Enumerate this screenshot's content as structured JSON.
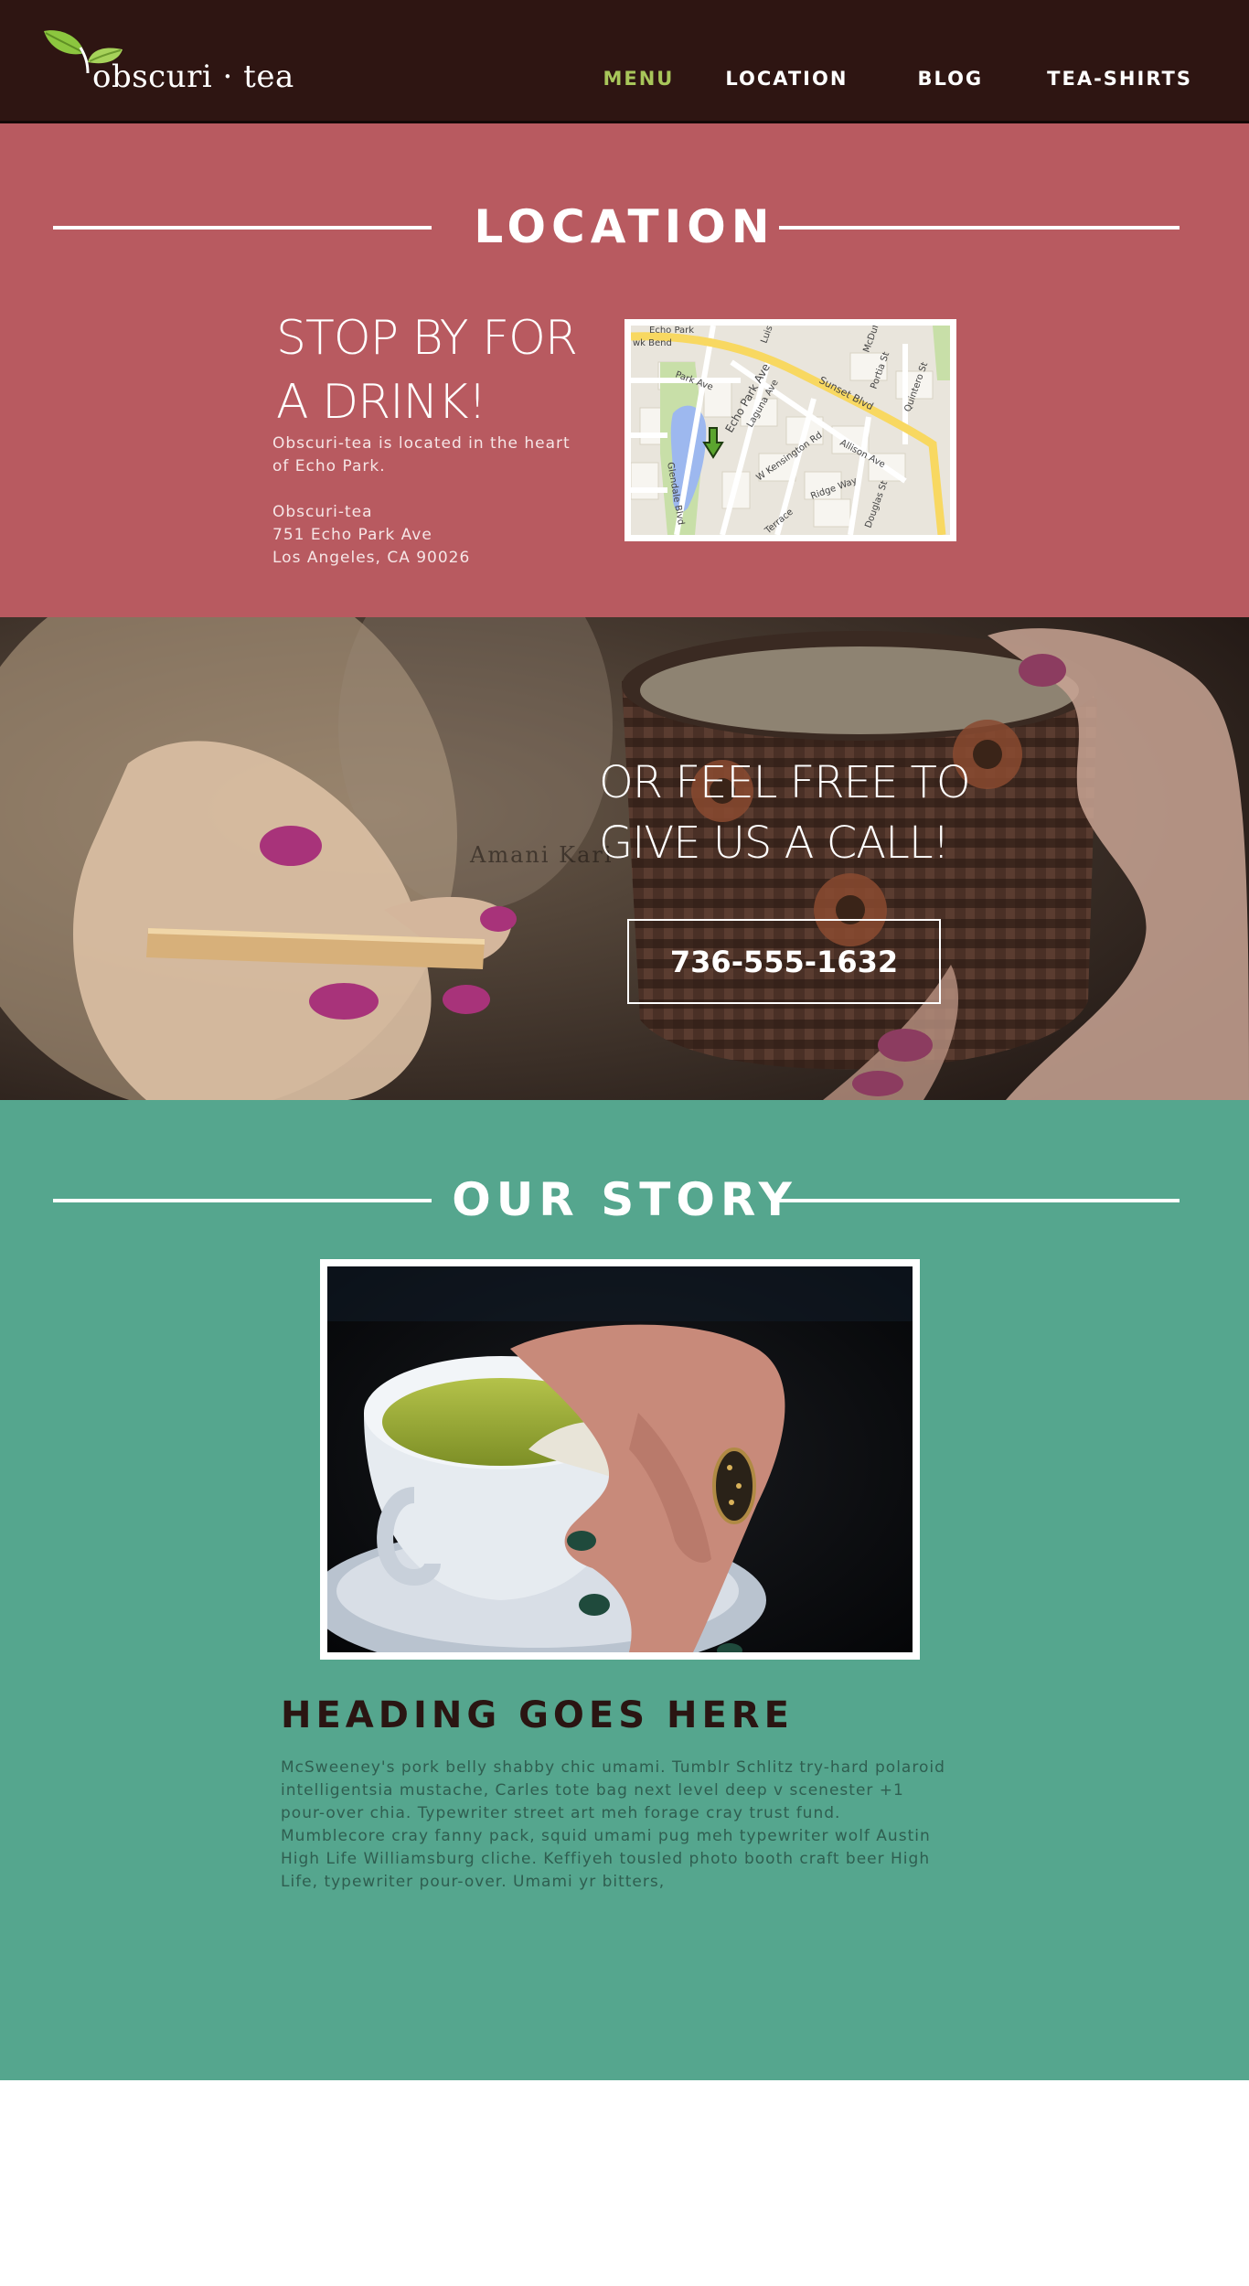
{
  "header": {
    "logo_text": "obscuri · tea",
    "nav": [
      {
        "label": "MENU",
        "active": true
      },
      {
        "label": "LOCATION",
        "active": false
      },
      {
        "label": "BLOG",
        "active": false
      },
      {
        "label": "TEA-SHIRTS",
        "active": false
      }
    ]
  },
  "location": {
    "title": "LOCATION",
    "heading": "STOP BY FOR A DRINK!",
    "description": "Obscuri-tea is located in the heart of Echo Park.",
    "address": {
      "name": "Obscuri-tea",
      "street": "751 Echo Park Ave",
      "city": "Los Angeles, CA 90026"
    },
    "map_labels": [
      "Echo Park",
      "wk Bend",
      "Park Ave",
      "Echo Park Ave",
      "Sunset Blvd",
      "Laguna Ave",
      "W Kensington Rd",
      "Allison Ave",
      "Ridge Way",
      "Douglas St",
      "Glendale Blvd",
      "Quintero St",
      "Portia St",
      "McDuff St",
      "Luis St",
      "Terrace"
    ]
  },
  "call": {
    "heading": "OR FEEL FREE TO GIVE US A CALL!",
    "phone": "736-555-1632",
    "watermark": "Amani Kari"
  },
  "story": {
    "title": "OUR STORY",
    "heading": "HEADING GOES HERE",
    "body": "McSweeney's pork belly shabby chic umami. Tumblr Schlitz try-hard polaroid intelligentsia mustache, Carles tote bag next level deep v scenester +1 pour-over chia. Typewriter street art meh forage cray trust fund. Mumblecore cray fanny pack, squid umami pug meh typewriter wolf Austin High Life Williamsburg cliche. Keffiyeh tousled photo booth craft beer High Life, typewriter pour-over. Umami yr bitters,"
  },
  "colors": {
    "header_bg": "#2e1512",
    "nav_active": "#a8c65a",
    "location_bg": "#b85a60",
    "story_bg": "#55a68e",
    "story_heading": "#2a1512"
  },
  "icons": [
    "tea-leaf-logo-icon",
    "map-pin-icon"
  ]
}
